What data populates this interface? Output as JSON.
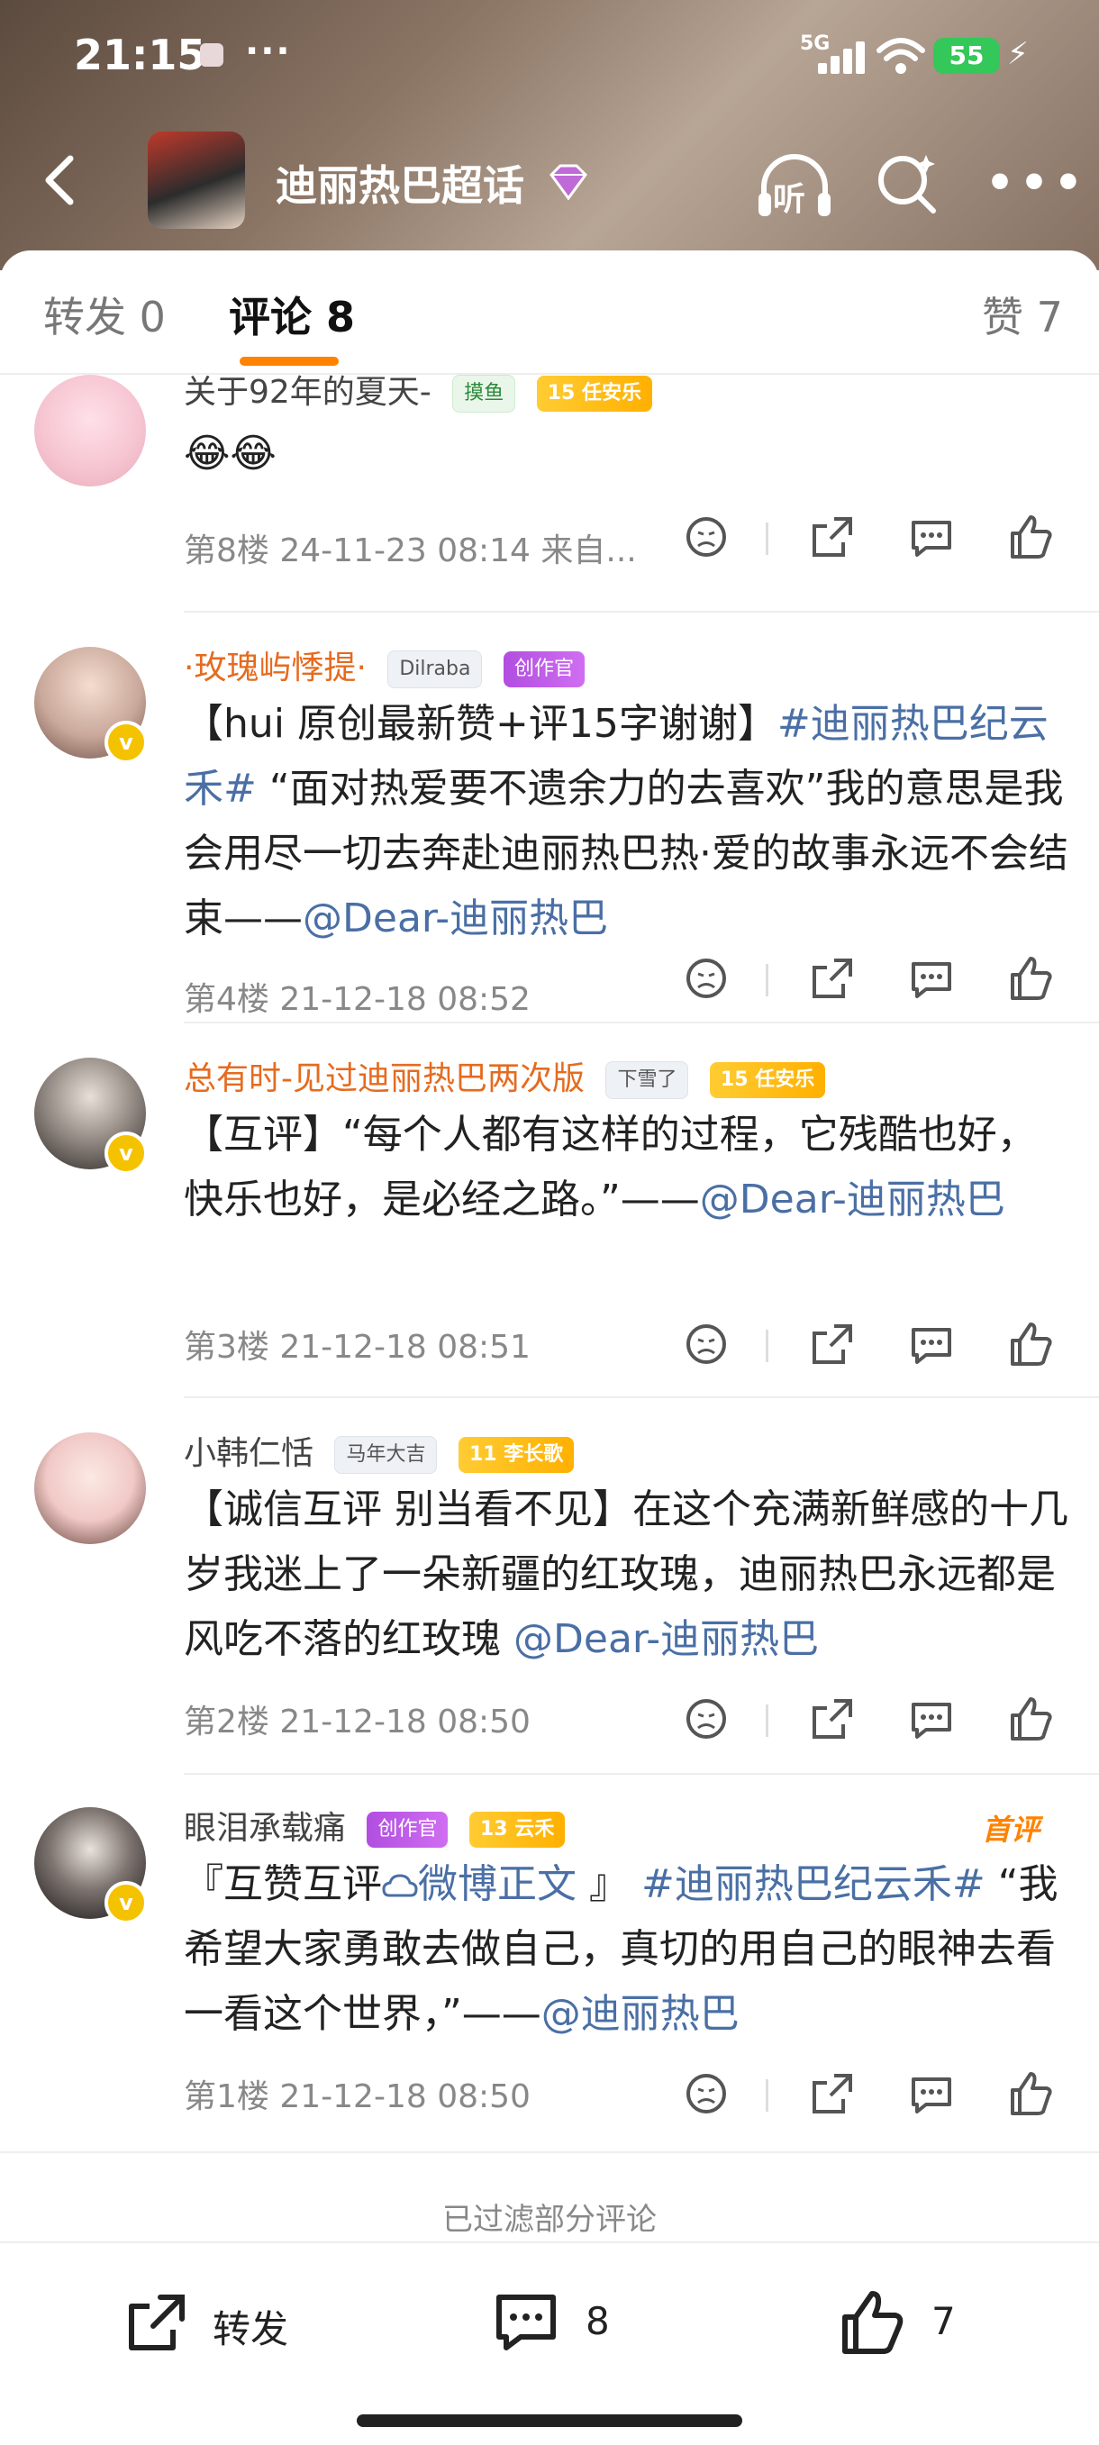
{
  "status_bar": {
    "time": "21:15",
    "dots": "···",
    "network": "5G",
    "battery": "55"
  },
  "header": {
    "title": "迪丽热巴超话"
  },
  "tabs": {
    "repost": "转发 0",
    "comments": "评论 8",
    "likes": "赞 7"
  },
  "comments": [
    {
      "name": "关于92年的夏天-",
      "badges": [
        "摸鱼",
        "15 任安乐"
      ],
      "text": "😂😂",
      "meta": "第8楼  24-11-23 08:14  来自..."
    },
    {
      "name": "·玫瑰屿悸提·",
      "badges": [
        "Dilraba",
        "创作官"
      ],
      "text_parts": [
        "【hui 原创最新赞+评15字谢谢】",
        "#迪丽热巴纪云禾#",
        " “面对热爱要不遗余力的去喜欢”我的意思是我会用尽一切去奔赴迪丽热巴热·爱的故事永远不会结束——",
        "@Dear-迪丽热巴"
      ],
      "meta": "第4楼  21-12-18 08:52"
    },
    {
      "name": "总有时-见过迪丽热巴两次版",
      "badges": [
        "下雪了",
        "15 任安乐"
      ],
      "text_parts": [
        "【互评】“每个人都有这样的过程，它残酷也好，快乐也好，是必经之路。”——",
        "@Dear-迪丽热巴"
      ],
      "meta": "第3楼  21-12-18 08:51"
    },
    {
      "name": "小韩仁恬",
      "badges": [
        "马年大吉",
        "11 李长歌"
      ],
      "text_parts": [
        "【诚信互评 别当看不见】在这个充满新鲜感的十几岁我迷上了一朵新疆的红玫瑰，迪丽热巴永远都是风吃不落的红玫瑰 ",
        "@Dear-迪丽热巴"
      ],
      "meta": "第2楼  21-12-18 08:50"
    },
    {
      "name": "眼泪承载痛",
      "badges": [
        "创作官",
        "13 云禾"
      ],
      "first_label": "首评",
      "text_parts": [
        "『互赞互评",
        "微博正文",
        " 』 ",
        "#迪丽热巴纪云禾#",
        " “我希望大家勇敢去做自己，真切的用自己的眼神去看一看这个世界，”——",
        "@迪丽热巴"
      ],
      "meta": "第1楼  21-12-18 08:50"
    }
  ],
  "footer": {
    "filtered_note": "已过滤部分评论",
    "repost_label": "转发",
    "comment_count": "8",
    "like_count": "7"
  },
  "colors": {
    "accent": "#ff8200",
    "link": "#4a6fa5",
    "vip_name": "#e56b1f"
  }
}
